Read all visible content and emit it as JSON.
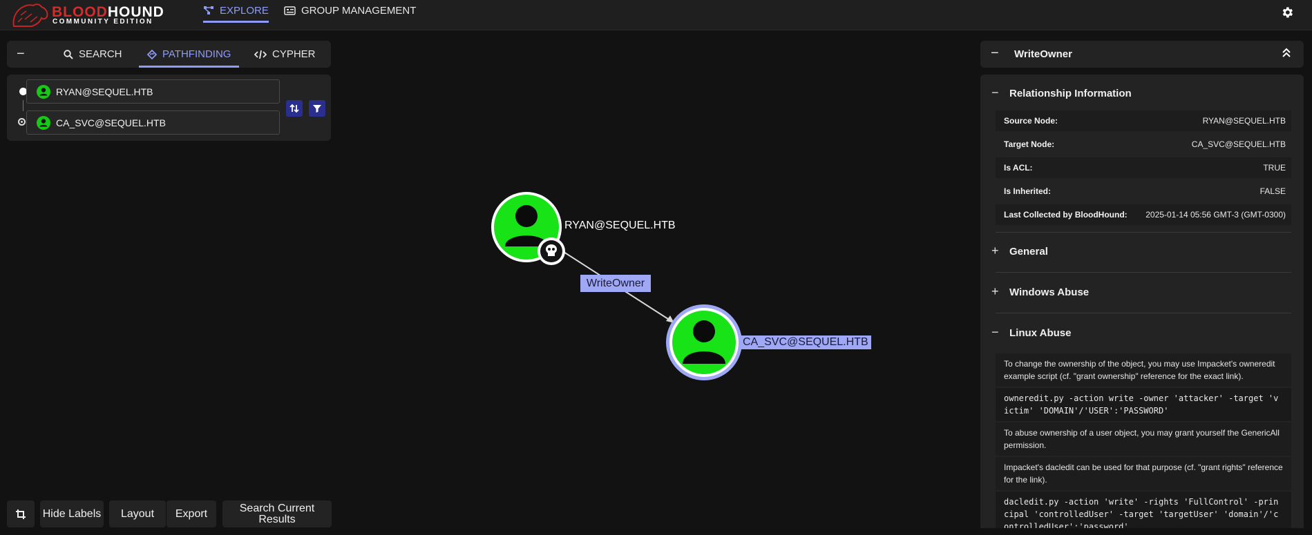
{
  "brand": {
    "line1_red": "BLOOD",
    "line1_white": "HOUND",
    "line2": "COMMUNITY EDITION"
  },
  "nav": {
    "explore": "EXPLORE",
    "group_management": "GROUP MANAGEMENT"
  },
  "left_panel": {
    "tabs": {
      "search": "SEARCH",
      "pathfinding": "PATHFINDING",
      "cypher": "CYPHER"
    },
    "start_node": "RYAN@SEQUEL.HTB",
    "end_node": "CA_SVC@SEQUEL.HTB"
  },
  "bottom_toolbar": {
    "hide_labels": "Hide Labels",
    "layout": "Layout",
    "export": "Export",
    "search_current_results": "Search Current Results"
  },
  "graph": {
    "source_label": "RYAN@SEQUEL.HTB",
    "target_label": "CA_SVC@SEQUEL.HTB",
    "edge_label": "WriteOwner"
  },
  "right_panel": {
    "title": "WriteOwner",
    "relationship_info": {
      "title": "Relationship Information",
      "rows": [
        {
          "key": "Source Node:",
          "value": "RYAN@SEQUEL.HTB"
        },
        {
          "key": "Target Node:",
          "value": "CA_SVC@SEQUEL.HTB"
        },
        {
          "key": "Is ACL:",
          "value": "TRUE"
        },
        {
          "key": "Is Inherited:",
          "value": "FALSE"
        },
        {
          "key": "Last Collected by BloodHound:",
          "value": "2025-01-14 05:56 GMT-3 (GMT-0300)"
        }
      ]
    },
    "general": "General",
    "windows_abuse": "Windows Abuse",
    "linux_abuse": {
      "title": "Linux Abuse",
      "p1": "To change the ownership of the object, you may use Impacket's owneredit example script (cf. \"grant ownership\" reference for the exact link).",
      "code1": "owneredit.py -action write -owner 'attacker' -target 'victim' 'DOMAIN'/'USER':'PASSWORD'",
      "p2": "To abuse ownership of a user object, you may grant yourself the GenericAll permission.",
      "p3": "Impacket's dacledit can be used for that purpose (cf. \"grant rights\" reference for the link).",
      "code2": "dacledit.py -action 'write' -rights 'FullControl' -principal 'controlledUser' -target 'targetUser' 'domain'/'controlledUser':'password'"
    }
  },
  "colors": {
    "accent": "#8f9cf7",
    "node_green": "#17e317",
    "edge_label_bg": "#9fa8f5",
    "brand_red": "#d62b2b"
  }
}
